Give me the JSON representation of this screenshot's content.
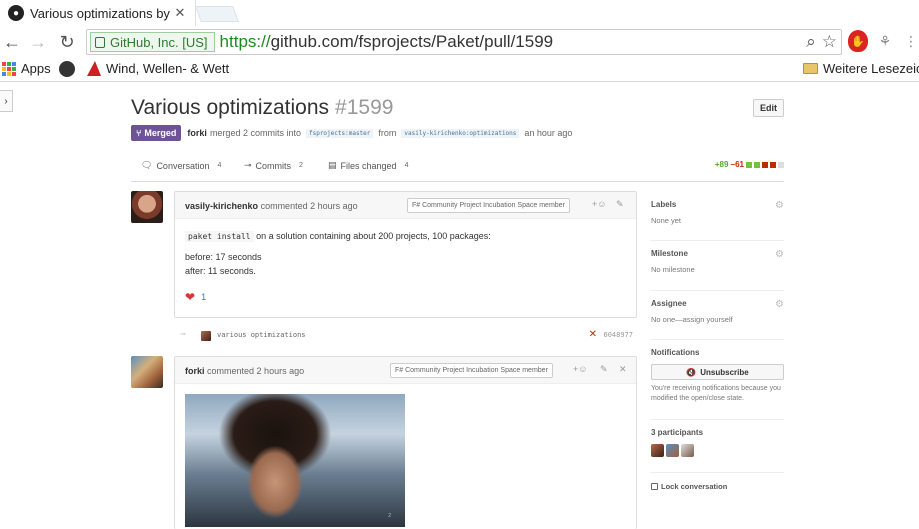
{
  "browser": {
    "tab_title": "Various optimizations by v",
    "tab_close": "✕",
    "ev_label": "GitHub, Inc. [US]",
    "url_scheme": "https://",
    "url_rest": "github.com/fsprojects/Paket/pull/1599",
    "bookmarks": [
      "Apps",
      "Wind, Wellen- & Wett",
      "Weitere Lesezeich"
    ]
  },
  "pr": {
    "title": "Various optimizations",
    "number": "#1599",
    "edit_label": "Edit",
    "state": "Merged",
    "merger": "forki",
    "merge_text": "merged 2 commits into",
    "base_branch": "fsprojects:master",
    "from_text": "from",
    "head_branch": "vasily-kirichenko:optimizations",
    "time": "an hour ago"
  },
  "tabs": [
    {
      "label": "Conversation",
      "count": "4"
    },
    {
      "label": "Commits",
      "count": "2"
    },
    {
      "label": "Files changed",
      "count": "4"
    }
  ],
  "diffstat": {
    "added": "+89",
    "removed": "−61"
  },
  "comments": [
    {
      "author": "vasily-kirichenko",
      "meta": "commented 2 hours ago",
      "badge": "F# Community Project Incubation Space member",
      "code": "paket install",
      "line1": "on a solution containing about 200 projects, 100 packages:",
      "line2": "before: 17 seconds",
      "line3": "after: 11 seconds.",
      "reaction_count": "1"
    },
    {
      "author": "forki",
      "meta": "commented 2 hours ago",
      "badge": "F# Community Project Incubation Space member",
      "gif_caption": "2"
    }
  ],
  "commit": {
    "message": "various optimizations",
    "sha": "6048977"
  },
  "sidebar": {
    "labels_title": "Labels",
    "labels_value": "None yet",
    "milestone_title": "Milestone",
    "milestone_value": "No milestone",
    "assignee_title": "Assignee",
    "assignee_value": "No one—assign yourself",
    "notifications_title": "Notifications",
    "unsubscribe_label": "Unsubscribe",
    "notify_reason": "You're receiving notifications because you modified the open/close state.",
    "participants_title": "3 participants",
    "lock_label": "Lock conversation"
  },
  "colors": {
    "merged": "#6e5494",
    "added": "#55a532",
    "removed": "#bd2c00",
    "link": "#4078c0"
  }
}
